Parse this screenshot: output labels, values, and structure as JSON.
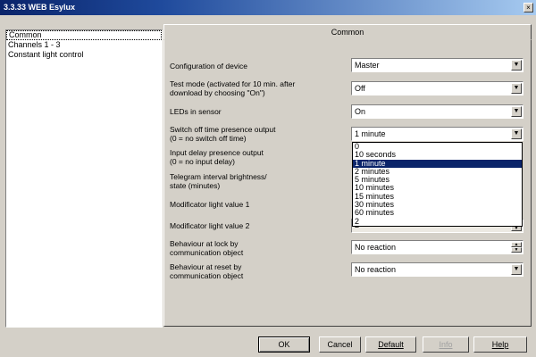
{
  "window": {
    "title": "3.3.33 WEB Esylux",
    "close_glyph": "×"
  },
  "sidebar": {
    "items": [
      {
        "label": "Common"
      },
      {
        "label": "Channels 1 - 3"
      },
      {
        "label": "Constant light control"
      }
    ]
  },
  "tab": {
    "label": "Common"
  },
  "params": [
    {
      "label": "Configuration of device",
      "value": "Master"
    },
    {
      "label_l1": "Test mode (activated for 10 min. after",
      "label_l2": "download by choosing \"On\")",
      "value": "Off"
    },
    {
      "label": "LEDs in sensor",
      "value": "On"
    },
    {
      "label_l1": "Switch off time presence output",
      "label_l2": "(0 = no switch off time)",
      "value": "1 minute"
    },
    {
      "label_l1": "Input delay presence output",
      "label_l2": "(0 = no input delay)"
    },
    {
      "label_l1": "Telegram interval brightness/",
      "label_l2": "state (minutes)"
    },
    {
      "label": "Modificator light value 1"
    },
    {
      "label": "Modificator light value 2",
      "value": "2"
    },
    {
      "label_l1": "Behaviour at lock by",
      "label_l2": "communication object",
      "value": "No reaction"
    },
    {
      "label_l1": "Behaviour at reset by",
      "label_l2": "communication object",
      "value": "No reaction"
    }
  ],
  "dropdown": {
    "options": [
      "0",
      "10 seconds",
      "1 minute",
      "2 minutes",
      "5 minutes",
      "10 minutes",
      "15 minutes",
      "30 minutes",
      "60 minutes",
      "2"
    ],
    "selected": "1 minute"
  },
  "buttons": {
    "ok": "OK",
    "cancel": "Cancel",
    "default": "Default",
    "info": "Info",
    "help": "Help"
  },
  "colors": {
    "titlebar": "#0a246a",
    "selection": "#0a246a",
    "face": "#d4d0c8"
  }
}
